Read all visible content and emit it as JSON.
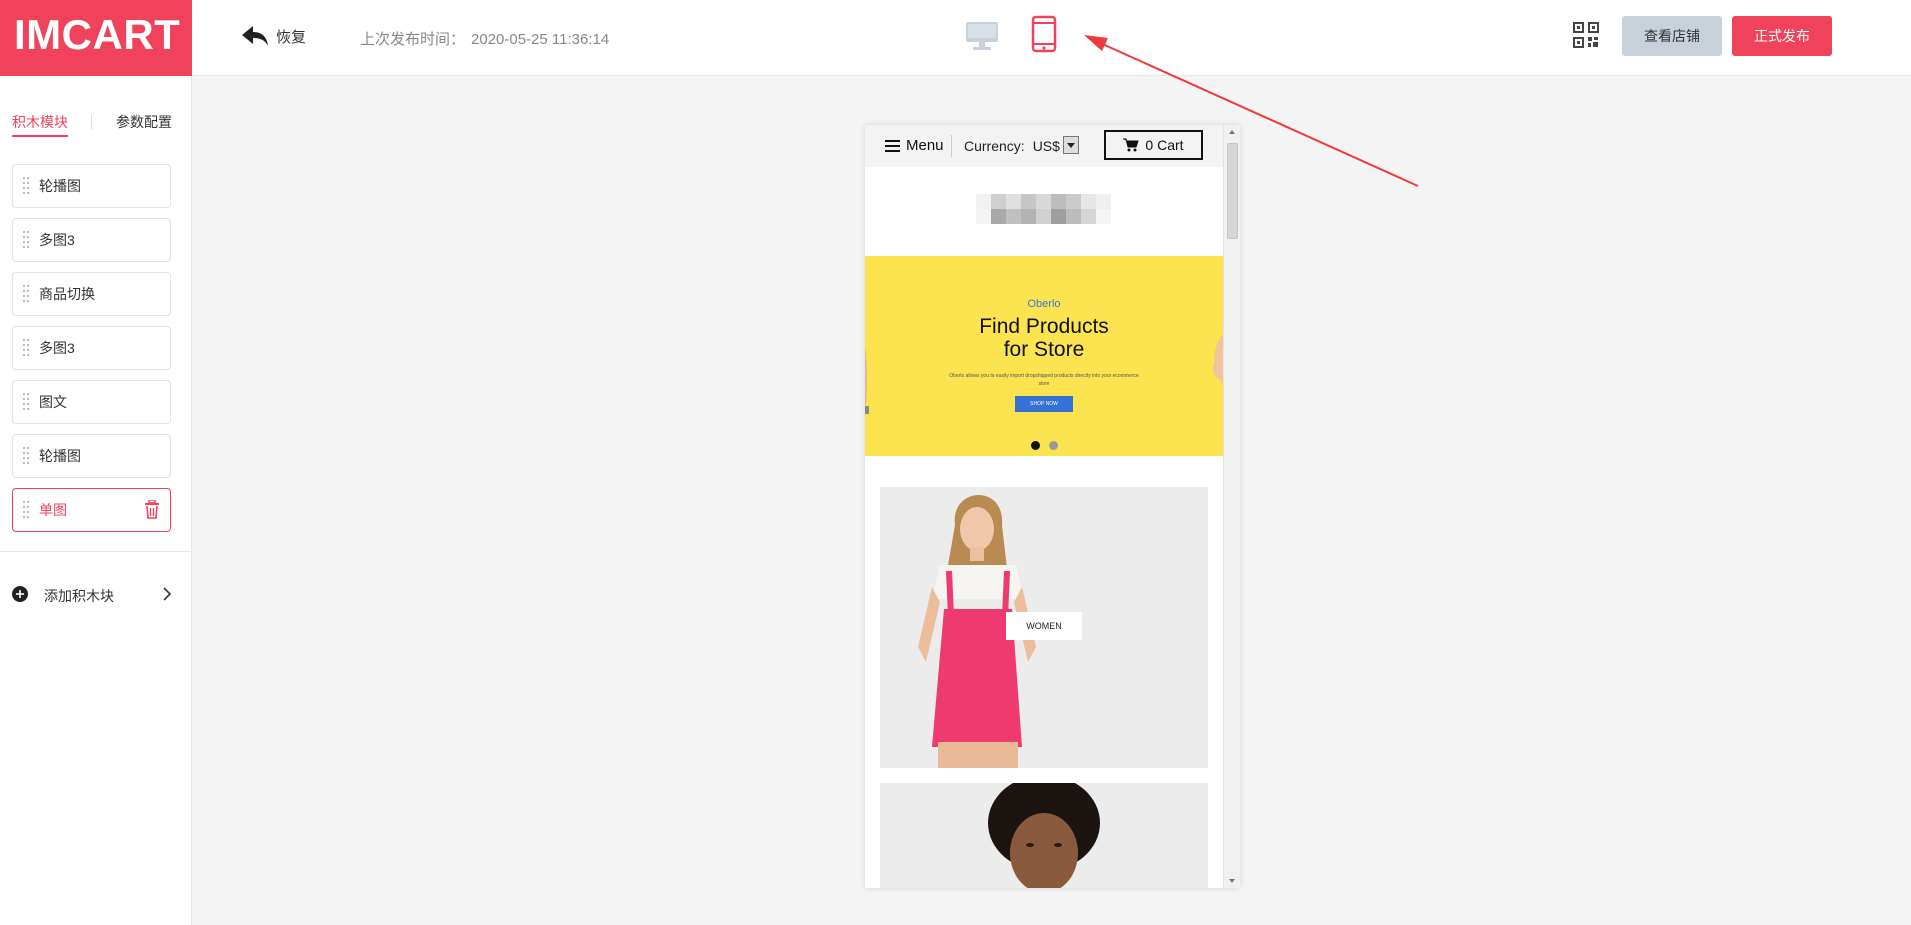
{
  "app": {
    "logo": "IMCART",
    "undo_label": "恢复",
    "last_publish_label": "上次发布时间：",
    "last_publish_time": "2020-05-25 11:36:14",
    "view_store_label": "查看店铺",
    "publish_label": "正式发布",
    "accent_color": "#f1425c",
    "active_device": "mobile"
  },
  "sidebar": {
    "tabs": [
      {
        "label": "积木模块",
        "active": true
      },
      {
        "label": "参数配置",
        "active": false
      }
    ],
    "blocks": [
      {
        "label": "轮播图"
      },
      {
        "label": "多图3"
      },
      {
        "label": "商品切换"
      },
      {
        "label": "多图3"
      },
      {
        "label": "图文"
      },
      {
        "label": "轮播图"
      },
      {
        "label": "单图",
        "active": true
      }
    ],
    "add_block_label": "添加积木块"
  },
  "preview": {
    "menu_label": "Menu",
    "currency_label": "Currency:",
    "currency_value": "US$",
    "cart_count": "0",
    "cart_label": "Cart",
    "banner": {
      "brand": "Oberlo",
      "headline_line1": "Find Products",
      "headline_line2": "for Store",
      "subtext": "Oberlo allows you to easily import dropshipped products directly into your ecommerce store",
      "button_label": "SHOP NOW",
      "background_color": "#fbe44f"
    },
    "card1_label": "WOMEN"
  }
}
